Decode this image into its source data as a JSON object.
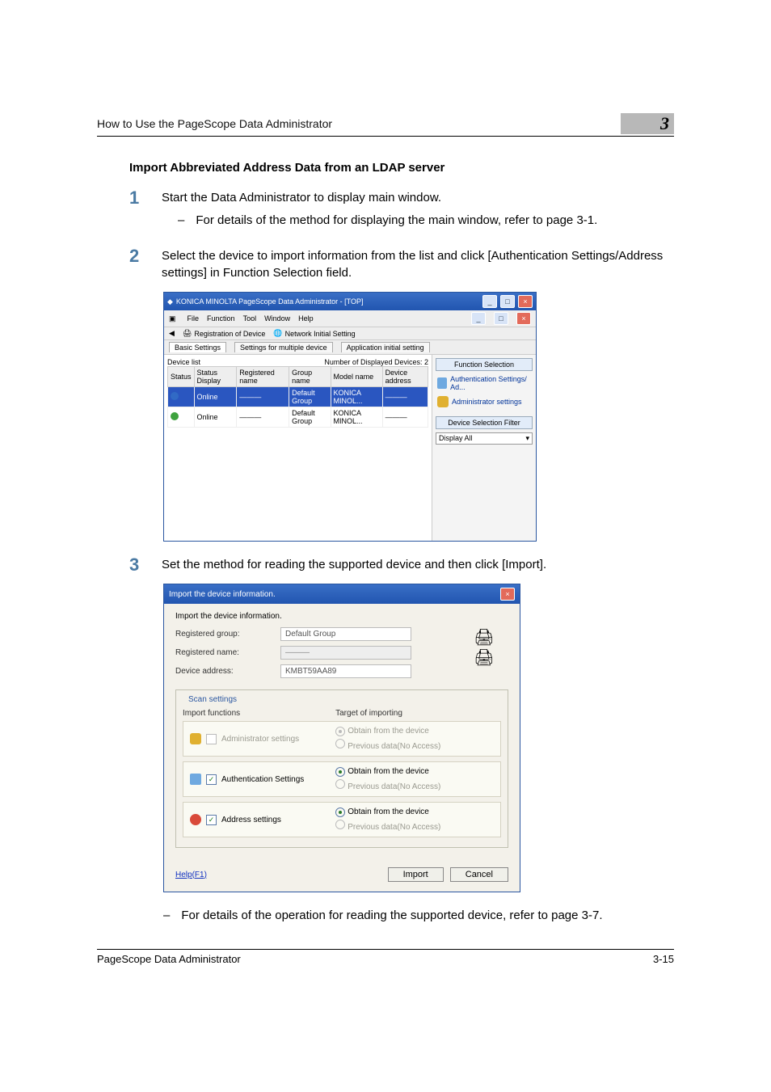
{
  "header": {
    "running_title": "How to Use the PageScope Data Administrator",
    "chapter_number": "3"
  },
  "section_title": "Import Abbreviated Address Data from an LDAP server",
  "steps": [
    {
      "num": "1",
      "text": "Start the Data Administrator to display main window.",
      "sub": [
        "For details of the method for displaying the main window, refer to page 3-1."
      ]
    },
    {
      "num": "2",
      "text": "Select the device to import information from the list and click [Authentication Settings/Address settings] in Function Selection field."
    },
    {
      "num": "3",
      "text": "Set the method for reading the supported device and then click [Import].",
      "sub_after": [
        "For details of the operation for reading the supported device, refer to page 3-7."
      ]
    }
  ],
  "screenshot1": {
    "title": "KONICA MINOLTA PageScope Data Administrator - [TOP]",
    "winbtns": {
      "min": "_",
      "max": "□",
      "close": "×",
      "inner_min": "_",
      "inner_max": "□",
      "inner_close": "×"
    },
    "menu": [
      "File",
      "Function",
      "Tool",
      "Window",
      "Help"
    ],
    "toolbar": [
      {
        "icon": "back-icon",
        "label": ""
      },
      {
        "icon": "register-icon",
        "label": "Registration of Device"
      },
      {
        "icon": "network-icon",
        "label": "Network Initial Setting"
      }
    ],
    "tabs": [
      "Basic Settings",
      "Settings for multiple device",
      "Application initial setting"
    ],
    "device_list_label": "Device list",
    "device_count_label": "Number of Displayed Devices",
    "device_count_value": "2",
    "columns": [
      "Status",
      "Status Display",
      "Registered name",
      "Group name",
      "Model name",
      "Device address"
    ],
    "rows": [
      {
        "status": "blue",
        "display": "Online",
        "name": "———",
        "group": "Default Group",
        "model": "KONICA MINOL...",
        "addr": "———",
        "selected": true
      },
      {
        "status": "green",
        "display": "Online",
        "name": "———",
        "group": "Default Group",
        "model": "KONICA MINOL...",
        "addr": "———",
        "selected": false
      }
    ],
    "right_panel": {
      "title": "Function Selection",
      "items": [
        "Authentication Settings/ Ad...",
        "Administrator settings"
      ],
      "filter_title": "Device Selection Filter",
      "filter_value": "Display All"
    }
  },
  "screenshot2": {
    "title": "Import the device information.",
    "close": "×",
    "intro": "Import the device information.",
    "fields": {
      "group_label": "Registered group:",
      "group_value": "Default Group",
      "name_label": "Registered name:",
      "name_value": "———",
      "addr_label": "Device address:",
      "addr_value": "KMBT59AA89"
    },
    "scan_title": "Scan settings",
    "col1": "Import functions",
    "col2": "Target of importing",
    "options": [
      {
        "icon": "mi-user",
        "checked": false,
        "disabled": true,
        "label": "Administrator settings",
        "targets": [
          {
            "label": "Obtain from the device",
            "checked": true,
            "disabled": true
          },
          {
            "label": "Previous data(No Access)",
            "checked": false,
            "disabled": true
          }
        ]
      },
      {
        "icon": "mi-auth",
        "checked": true,
        "disabled": false,
        "label": "Authentication Settings",
        "targets": [
          {
            "label": "Obtain from the device",
            "checked": true,
            "disabled": false
          },
          {
            "label": "Previous data(No Access)",
            "checked": false,
            "disabled": true
          }
        ]
      },
      {
        "icon": "mi-addr",
        "checked": true,
        "disabled": false,
        "label": "Address settings",
        "targets": [
          {
            "label": "Obtain from the device",
            "checked": true,
            "disabled": false
          },
          {
            "label": "Previous data(No Access)",
            "checked": false,
            "disabled": true
          }
        ]
      }
    ],
    "help": "Help(F1)",
    "buttons": {
      "import": "Import",
      "cancel": "Cancel"
    }
  },
  "footer": {
    "product": "PageScope Data Administrator",
    "page": "3-15"
  }
}
